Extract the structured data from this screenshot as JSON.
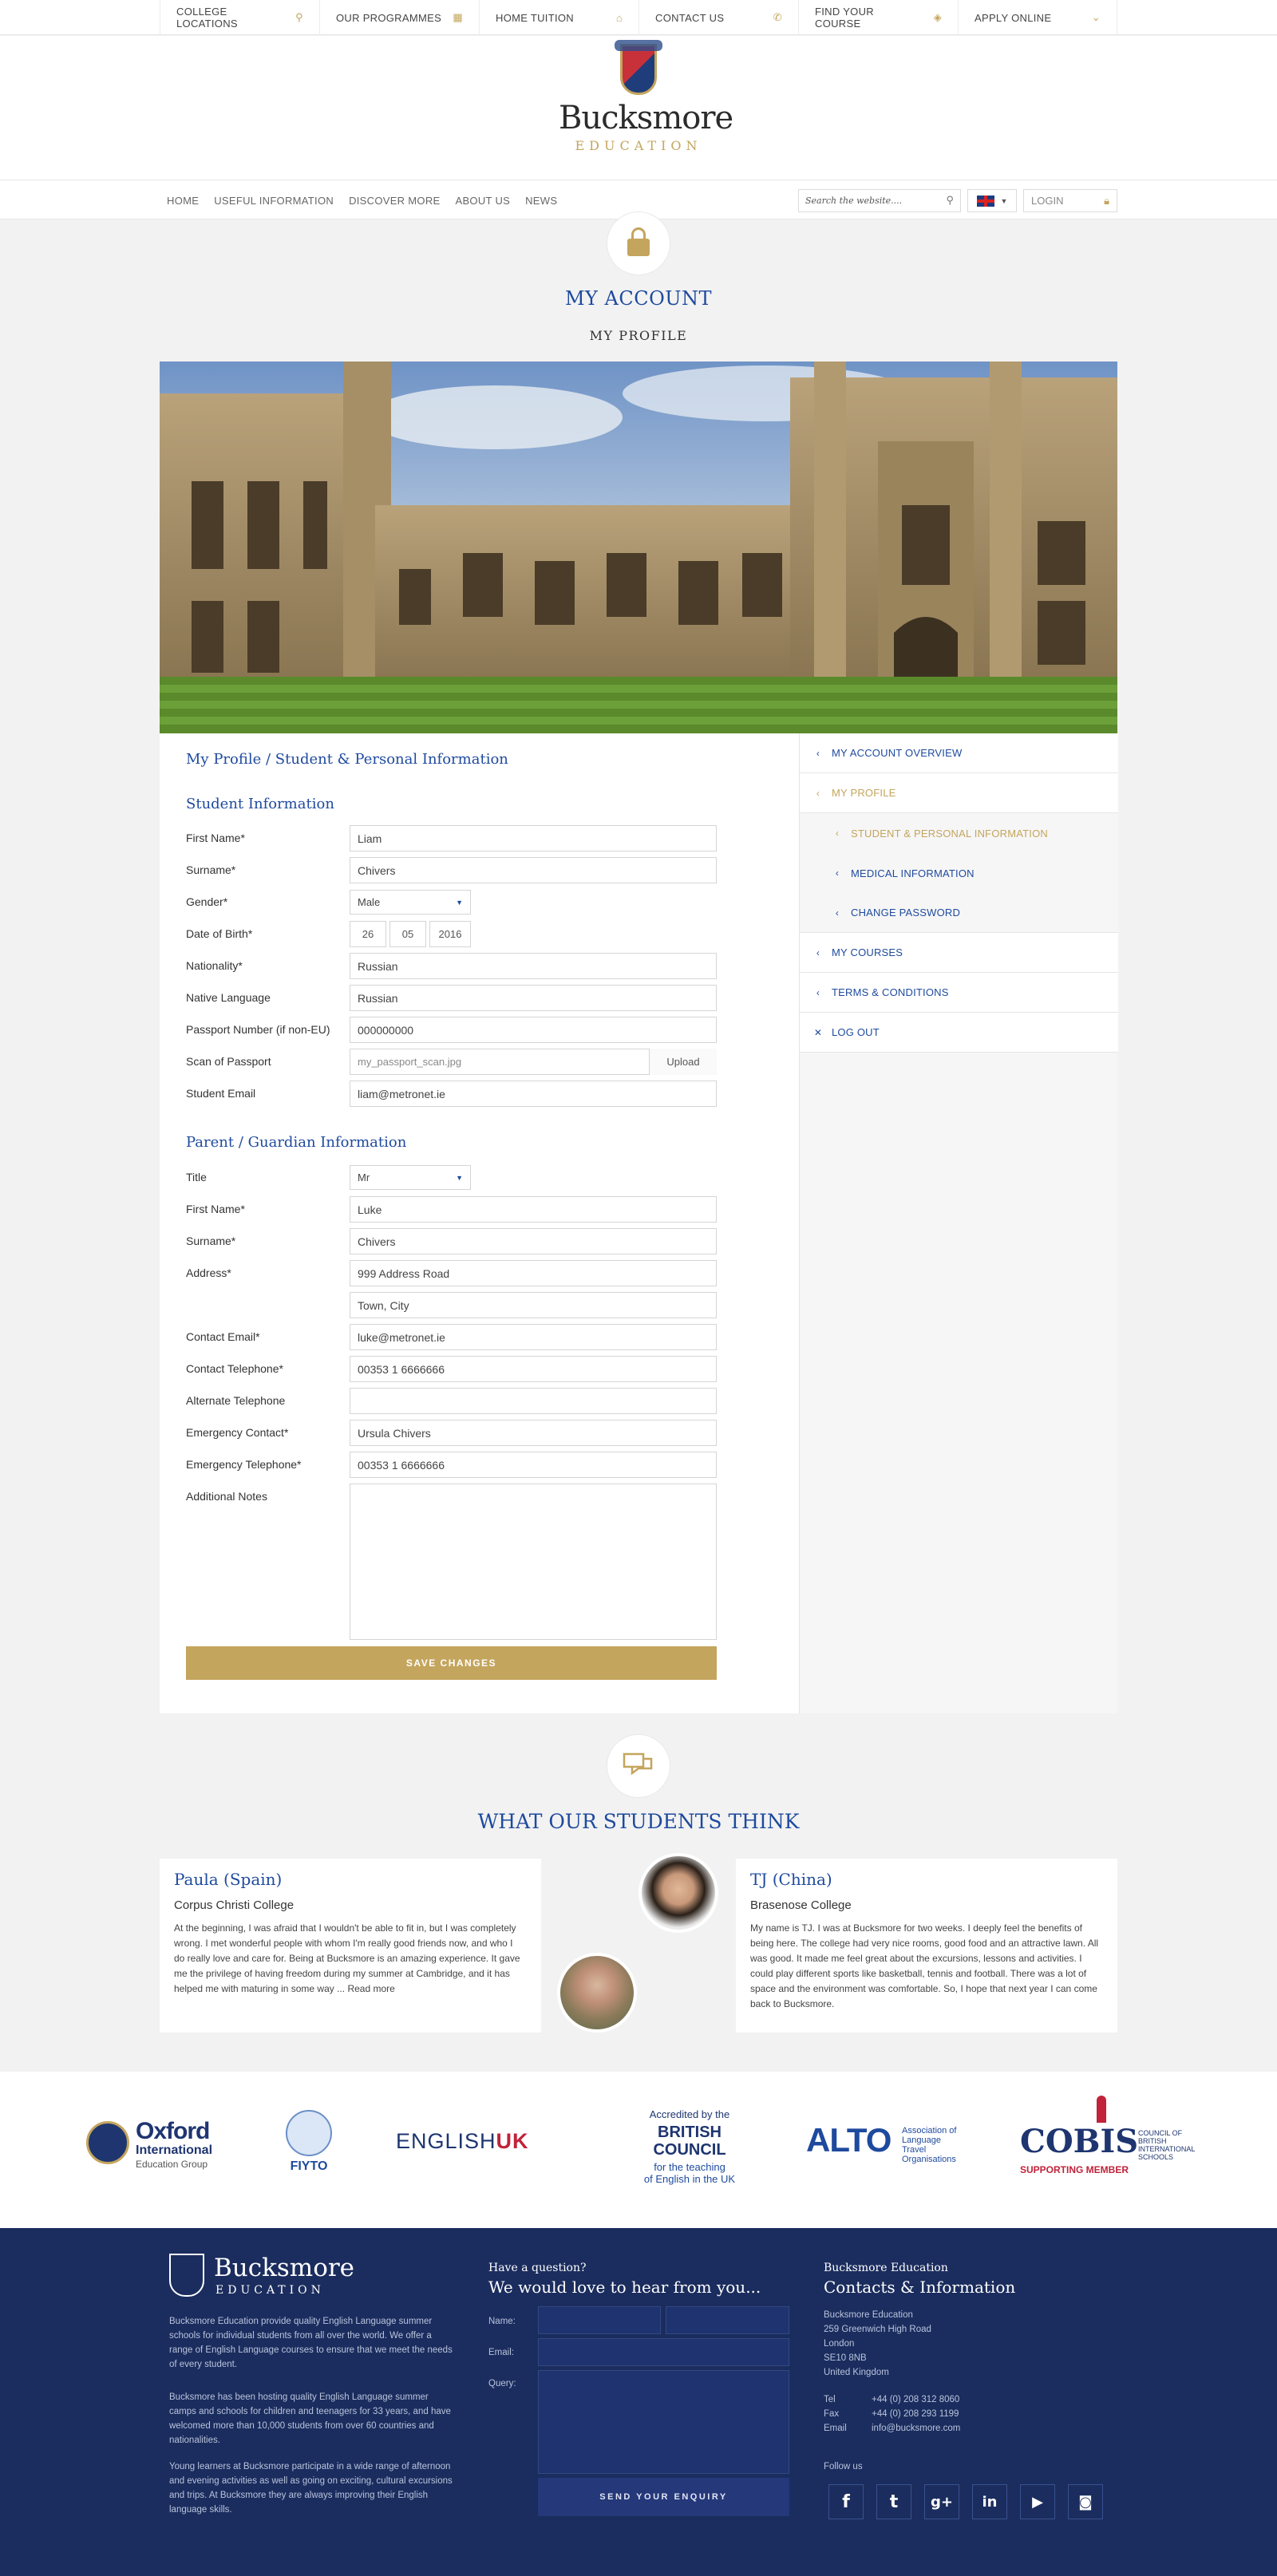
{
  "topbar": {
    "items": [
      {
        "label": "COLLEGE LOCATIONS",
        "icon": "map-pin-icon"
      },
      {
        "label": "OUR PROGRAMMES",
        "icon": "grid-icon"
      },
      {
        "label": "HOME TUITION",
        "icon": "house-icon"
      },
      {
        "label": "CONTACT US",
        "icon": "phone-icon"
      },
      {
        "label": "FIND YOUR COURSE",
        "icon": "compass-icon"
      },
      {
        "label": "APPLY ONLINE",
        "icon": "chevron-down-icon"
      }
    ]
  },
  "logo": {
    "name": "Bucksmore",
    "sub": "EDUCATION"
  },
  "nav": {
    "items": [
      "HOME",
      "USEFUL INFORMATION",
      "DISCOVER MORE",
      "ABOUT US",
      "NEWS"
    ],
    "search_placeholder": "Search the website....",
    "login": "LOGIN"
  },
  "page": {
    "title": "MY ACCOUNT",
    "subtitle": "MY PROFILE"
  },
  "sidebar": {
    "items": [
      {
        "label": "MY ACCOUNT OVERVIEW"
      },
      {
        "label": "MY PROFILE"
      },
      {
        "label": "STUDENT & PERSONAL INFORMATION"
      },
      {
        "label": "MEDICAL INFORMATION"
      },
      {
        "label": "CHANGE PASSWORD"
      },
      {
        "label": "MY COURSES"
      },
      {
        "label": "TERMS & CONDITIONS"
      },
      {
        "label": "LOG OUT"
      }
    ]
  },
  "form": {
    "title": "My Profile / Student & Personal Information",
    "student_section": "Student Information",
    "student": {
      "first_name_label": "First Name*",
      "first_name": "Liam",
      "surname_label": "Surname*",
      "surname": "Chivers",
      "gender_label": "Gender*",
      "gender": "Male",
      "dob_label": "Date of Birth*",
      "dob_day": "26",
      "dob_month": "05",
      "dob_year": "2016",
      "nationality_label": "Nationality*",
      "nationality": "Russian",
      "language_label": "Native Language",
      "language": "Russian",
      "passport_label": "Passport Number (if non-EU)",
      "passport": "000000000",
      "scan_label": "Scan of Passport",
      "scan": "my_passport_scan.jpg",
      "upload": "Upload",
      "email_label": "Student Email",
      "email": "liam@metronet.ie"
    },
    "guardian_section": "Parent / Guardian Information",
    "guardian": {
      "title_label": "Title",
      "title": "Mr",
      "first_name_label": "First Name*",
      "first_name": "Luke",
      "surname_label": "Surname*",
      "surname": "Chivers",
      "address_label": "Address*",
      "address1": "999 Address Road",
      "address2": "Town, City",
      "email_label": "Contact Email*",
      "email": "luke@metronet.ie",
      "phone_label": "Contact Telephone*",
      "phone": "00353 1 6666666",
      "alt_phone_label": "Alternate Telephone",
      "alt_phone": "",
      "emergency_label": "Emergency Contact*",
      "emergency": "Ursula Chivers",
      "emergency_phone_label": "Emergency Telephone*",
      "emergency_phone": "00353 1 6666666",
      "notes_label": "Additional Notes"
    },
    "save": "SAVE CHANGES"
  },
  "testimonials": {
    "heading": "WHAT OUR STUDENTS THINK",
    "items": [
      {
        "name": "Paula (Spain)",
        "college": "Corpus Christi College",
        "text": "At the beginning, I was afraid that I wouldn't be able to fit in, but I was completely wrong. I met wonderful people with whom I'm really good friends now, and who I do really love and care for. Being at Bucksmore is an amazing experience. It gave me the privilege of having freedom during my summer at Cambridge, and it has helped me with  maturing in some way ...",
        "more": "Read more"
      },
      {
        "name": "TJ (China)",
        "college": "Brasenose College",
        "text": "My name is TJ. I was at Bucksmore for two weeks. I deeply feel the benefits of being here. The college had very nice rooms, good food and an attractive lawn. All was good. It made me feel great about the excursions, lessons and activities. I could play different sports like basketball, tennis and football. There was a lot of space and the environment was comfortable. So, I hope that next year I can come back to Bucksmore."
      }
    ]
  },
  "partners": {
    "oxford": {
      "l1": "Oxford",
      "l2": "International",
      "l3": "Education Group"
    },
    "fiyto": "FIYTO",
    "englishuk": {
      "a": "ENGLISH",
      "b": "UK"
    },
    "british": {
      "top": "Accredited by the",
      "l1": "BRITISH",
      "l2": "COUNCIL",
      "bottom1": "for the teaching",
      "bottom2": "of English in the UK"
    },
    "alto": {
      "name": "ALTO",
      "l1": "Association of",
      "l2": "Language Travel",
      "l3": "Organisations"
    },
    "cobis": {
      "name": "COBIS",
      "l1": "COUNCIL OF",
      "l2": "BRITISH",
      "l3": "INTERNATIONAL",
      "l4": "SCHOOLS",
      "member": "SUPPORTING MEMBER"
    }
  },
  "footer": {
    "logo_name": "Bucksmore",
    "logo_sub": "EDUCATION",
    "para1": "Bucksmore Education provide quality English Language summer schools for individual students from all over the world. We offer a range of English Language courses to ensure that we meet the needs of every student.",
    "para2": "Bucksmore has been hosting quality English Language summer camps and schools for children and teenagers for 33 years, and have welcomed more than 10,000 students from over 60 countries and nationalities.",
    "para3": "Young learners at Bucksmore participate in a wide range of afternoon and evening activities as well as going on exciting, cultural excursions and trips. At Bucksmore they are always improving their English language skills.",
    "question_small": "Have a question?",
    "question_big": "We would love to hear from you...",
    "name_label": "Name:",
    "email_label": "Email:",
    "query_label": "Query:",
    "send": "SEND YOUR ENQUIRY",
    "contact_small": "Bucksmore Education",
    "contact_big": "Contacts & Information",
    "address": [
      "Bucksmore Education",
      "259 Greenwich High Road",
      "London",
      "SE10 8NB",
      "United Kingdom"
    ],
    "tel_label": "Tel",
    "tel": "+44 (0) 208 312 8060",
    "fax_label": "Fax",
    "fax": "+44 (0) 208 293 1199",
    "email2_label": "Email",
    "email2": "info@bucksmore.com",
    "follow": "Follow us",
    "social": [
      "f",
      "t",
      "g+",
      "in",
      "yt",
      "ig"
    ]
  },
  "colors": {
    "navy": "#1e4a9e",
    "gold": "#c4a55d",
    "footer": "#1b2d5e"
  }
}
